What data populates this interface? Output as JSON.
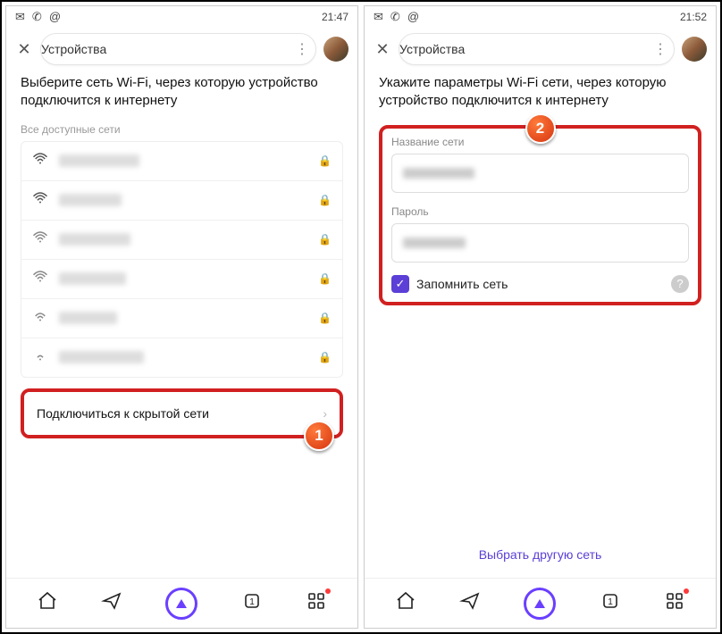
{
  "left": {
    "status": {
      "time": "21:47"
    },
    "header": {
      "title": "Устройства"
    },
    "heading": "Выберите сеть Wi-Fi, через которую устройство подключится к интернету",
    "section_label": "Все доступные сети",
    "hidden_network_label": "Подключиться к скрытой сети",
    "callout_num": "1"
  },
  "right": {
    "status": {
      "time": "21:52"
    },
    "header": {
      "title": "Устройства"
    },
    "heading": "Укажите параметры Wi-Fi сети, через которую устройство подключится к интернету",
    "ssid_label": "Название сети",
    "password_label": "Пароль",
    "remember_label": "Запомнить сеть",
    "alt_link": "Выбрать другую сеть",
    "callout_num": "2"
  }
}
